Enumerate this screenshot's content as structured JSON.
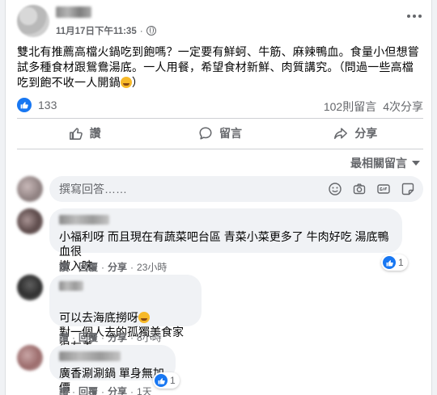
{
  "post": {
    "timestamp": "11月17日下午11:35",
    "separator": "·",
    "text": "雙北有推薦高檔火鍋吃到飽嗎？一定要有鮮蚵、牛筋、麻辣鴨血。食量小但想嘗試多種食材跟鴛鴦湯底。一人用餐，希望食材新鮮、肉質講究。（問過一些高檔吃到飽不收一人開鍋",
    "text_end": "）",
    "like_count": "133",
    "comment_count": "102則留言",
    "share_count": "4次分享"
  },
  "actions": {
    "like_label": "讚",
    "comment_label": "留言",
    "share_label": "分享"
  },
  "sort_label": "最相關留言",
  "composer": {
    "placeholder": "撰寫回答……"
  },
  "comments": [
    {
      "text": "小福利呀 而且現在有蔬菜吧台區 青菜小菜更多了 牛肉好吃 湯底鴨血很\n嫩入味",
      "like": "讚",
      "reply": "回覆",
      "share": "分享",
      "time": "23小時",
      "dot": "·",
      "reactions": "1"
    },
    {
      "text": "可以去海底撈呀",
      "text2": "對一個人去的孤獨美食家很友善~",
      "like": "讚",
      "reply": "回覆",
      "share": "分享",
      "time": "8小時",
      "dot": "·"
    },
    {
      "text": "廣香涮涮鍋 單身無加價",
      "like": "讚",
      "reply": "回覆",
      "share": "分享",
      "time": "1天",
      "dot": "·",
      "reactions": "1"
    }
  ],
  "colors": {
    "accent": "#1877f2",
    "muted": "#65676b",
    "bubble": "#f0f2f5"
  }
}
